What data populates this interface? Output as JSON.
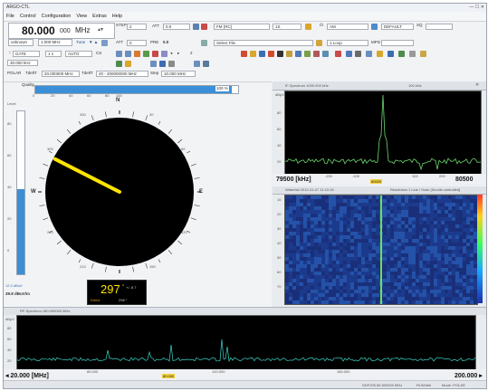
{
  "app": {
    "title": "ARGO-CTL"
  },
  "menu": [
    "File",
    "Control",
    "Configuration",
    "View",
    "Extras",
    "Help"
  ],
  "frequency": {
    "value": "80.000",
    "value_small": "000",
    "unit": "MHz"
  },
  "toolbar": {
    "step_label": "STEP",
    "step_value": "2",
    "mode_value": "unknown",
    "step2_value": "1.000 MHz",
    "tune_label": "Tune",
    "att_label": "ATT",
    "att_value": "0.0",
    "pre_label": "PRE",
    "mode_ctrl": "FM (RC)",
    "afc_value": "1S",
    "agc_label": "AM",
    "default_label": "DEFAULT",
    "sq_label": "SQ",
    "bw_value": "1.1 kHz",
    "select_file": "Select File",
    "loop_value": "1 Loop",
    "mpg_label": "MPG",
    "mode_label": "GATE",
    "count_value": "1 s",
    "auto_value": "AUTO",
    "gain_value": "30.000 kHz",
    "cfg_label": "CS",
    "polar_label": "POLAR",
    "tdelta_label": "TdeltT",
    "tdelta_value": "20.000000 MHz",
    "tdelta_t": "TdeltT",
    "tdelta_t_value": "20 - 200000000 MHz",
    "step_lbl2": "Step",
    "step_value2": "10.000 MHz"
  },
  "quality": {
    "label": "Quality",
    "value": "100 %",
    "level_fraction": 0.97,
    "ticks": [
      "0",
      "20",
      "40",
      "60",
      "80",
      "100"
    ]
  },
  "level": {
    "label": "Level",
    "value_text": "39.8 dBuV/m",
    "min_label": "12.3 dBuV",
    "ticks": [
      "80",
      "60",
      "40",
      "20",
      "0"
    ],
    "level_fraction": 0.52,
    "fill_color": "#3a8fd8"
  },
  "compass": {
    "n_label": "N",
    "e_label": "E",
    "s_label": "S",
    "w_label": "W",
    "angle_deg": 297,
    "tick_labels": [
      "30",
      "60",
      "120",
      "150",
      "210",
      "240",
      "300",
      "330"
    ],
    "needle_color": "#ffe400"
  },
  "bearing": {
    "value": "297",
    "unit": "°",
    "spread": "+/- 8.7",
    "label": "Bearing",
    "quality_label": "Direct",
    "quality_value": "298 °"
  },
  "if_spectrum": {
    "title": "IF-Spectrum 1000.000 kHz",
    "header_right": "100 kHz",
    "y_unit": "dBμV",
    "x_left": "79500 [kHz]",
    "x_right": "80500",
    "x_ticks": [
      "-200",
      "-100",
      "0",
      "100",
      "200"
    ],
    "y_ticks": [
      "80",
      "60",
      "40",
      "20",
      "0"
    ],
    "marker": "80000"
  },
  "waterfall": {
    "title": "Waterfall 2012-01-07 11:10:16",
    "right_text": "Resolution 1 Line / Scan [Scrolls controlled]",
    "y_ticks": [
      "10",
      "20",
      "30",
      "40",
      "50",
      "60",
      "70"
    ],
    "x_ticks": [
      "-200",
      "-100",
      "0",
      "100",
      "200"
    ],
    "colors": [
      "#1c3a8c",
      "#2452a8",
      "#1a2f7a"
    ],
    "signal_color": "#6ede5a"
  },
  "rf_spectrum": {
    "title": "RF-Spectrum 180.000000 MHz",
    "y_unit": "dBμV",
    "x_left": "◂ 20.000 [MHz]",
    "x_right": "200.000 ▸",
    "x_ticks": [
      "20.000",
      "80.000",
      "120.000",
      "160.000",
      "200.000"
    ],
    "marker": "80.000",
    "y_ticks": [
      "100",
      "80",
      "60",
      "40",
      "20"
    ]
  },
  "status_bar": {
    "freq": "DDF205  66.500000 MHz",
    "mode": "RUN/Idle",
    "mode_polar": "Mode: POLAR"
  }
}
